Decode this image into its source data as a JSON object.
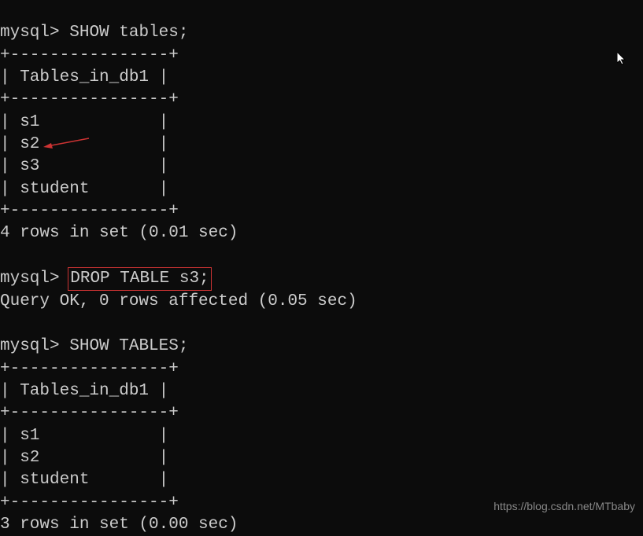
{
  "terminal": {
    "prompt": "mysql>",
    "cmd1": "SHOW tables;",
    "border_top1": "+----------------+",
    "header1": "| Tables_in_db1 |",
    "border_mid1": "+----------------+",
    "row1_1": "| s1            |",
    "row1_2": "| s2            |",
    "row1_3": "| s3            |",
    "row1_4": "| student       |",
    "border_bot1": "+----------------+",
    "result1": "4 rows in set (0.01 sec)",
    "cmd2": "DROP TABLE s3;",
    "result2": "Query OK, 0 rows affected (0.05 sec)",
    "cmd3": "SHOW TABLES;",
    "border_top2": "+----------------+",
    "header2": "| Tables_in_db1 |",
    "border_mid2": "+----------------+",
    "row2_1": "| s1            |",
    "row2_2": "| s2            |",
    "row2_3": "| student       |",
    "border_bot2": "+----------------+",
    "result3": "3 rows in set (0.00 sec)"
  },
  "watermark": "https://blog.csdn.net/MTbaby"
}
